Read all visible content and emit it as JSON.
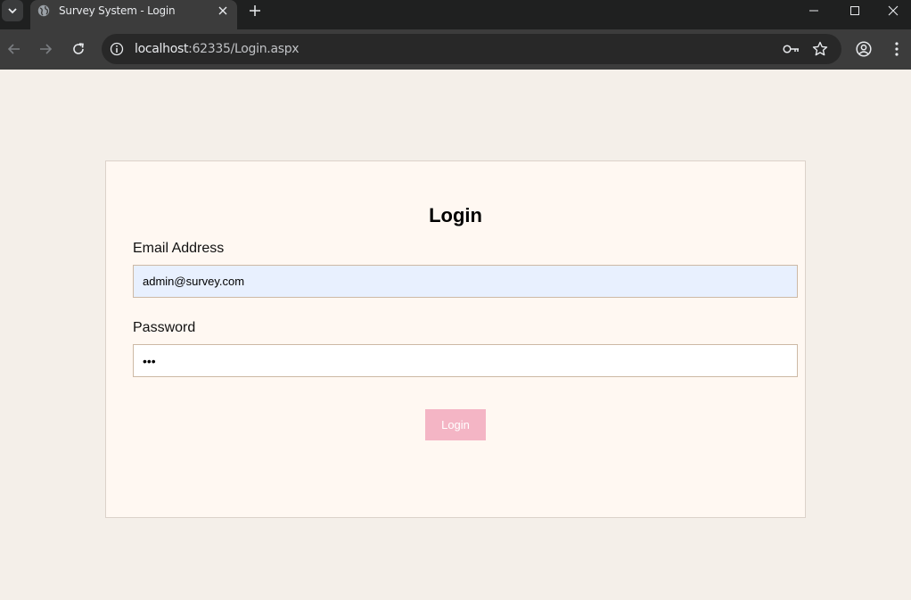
{
  "browser": {
    "tab_title": "Survey System - Login",
    "url_host": "localhost",
    "url_path": ":62335/Login.aspx"
  },
  "page": {
    "title": "Login",
    "email_label": "Email Address",
    "email_value": "admin@survey.com",
    "password_label": "Password",
    "password_value": "abc",
    "login_button": "Login"
  },
  "colors": {
    "page_background": "#f4efe9",
    "card_background": "#fff8f2",
    "button_background": "#f4b5c5",
    "autofill_background": "#e8f0fe"
  }
}
